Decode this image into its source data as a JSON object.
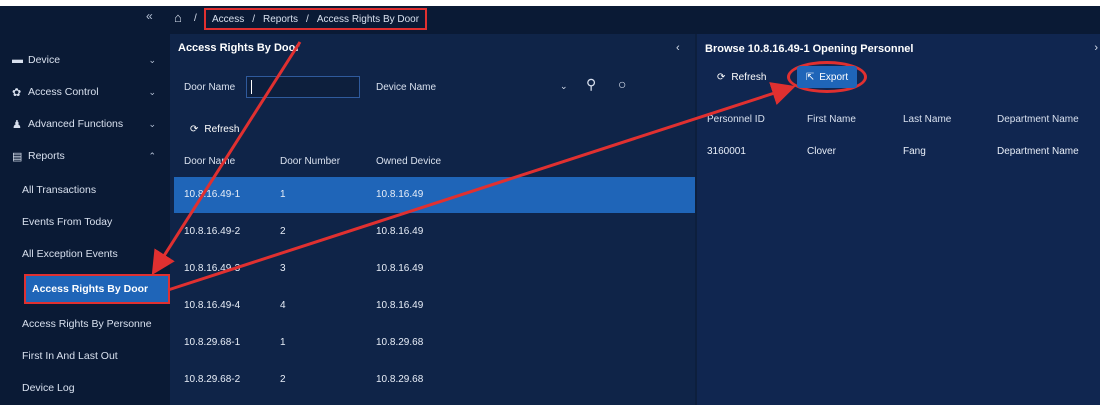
{
  "sidebar": {
    "collapse_icon": "double-chevron-left-icon",
    "items": [
      {
        "label": "Device",
        "icon": "device-icon"
      },
      {
        "label": "Access Control",
        "icon": "gear-icon"
      },
      {
        "label": "Advanced Functions",
        "icon": "person-icon"
      },
      {
        "label": "Reports",
        "icon": "report-icon"
      }
    ],
    "sub_items": [
      "All Transactions",
      "Events From Today",
      "All Exception Events",
      "Access Rights By Door",
      "Access Rights By Personne",
      "First In And Last Out",
      "Device Log"
    ]
  },
  "breadcrumb": {
    "home_icon": "home-icon",
    "items": [
      "Access",
      "Reports",
      "Access Rights By Door"
    ]
  },
  "main": {
    "title": "Access Rights By Door",
    "door_name_label": "Door Name",
    "door_name_value": "",
    "device_name_label": "Device Name",
    "refresh_label": "Refresh",
    "columns": [
      "Door Name",
      "Door Number",
      "Owned Device"
    ],
    "rows": [
      {
        "door": "10.8.16.49-1",
        "number": "1",
        "device": "10.8.16.49"
      },
      {
        "door": "10.8.16.49-2",
        "number": "2",
        "device": "10.8.16.49"
      },
      {
        "door": "10.8.16.49-3",
        "number": "3",
        "device": "10.8.16.49"
      },
      {
        "door": "10.8.16.49-4",
        "number": "4",
        "device": "10.8.16.49"
      },
      {
        "door": "10.8.29.68-1",
        "number": "1",
        "device": "10.8.29.68"
      },
      {
        "door": "10.8.29.68-2",
        "number": "2",
        "device": "10.8.29.68"
      }
    ]
  },
  "right_panel": {
    "title": "Browse 10.8.16.49-1 Opening Personnel",
    "refresh_label": "Refresh",
    "export_label": "Export",
    "columns": [
      "Personnel ID",
      "First Name",
      "Last Name",
      "Department Name"
    ],
    "rows": [
      {
        "id": "3160001",
        "first": "Clover",
        "last": "Fang",
        "dept": "Department Name"
      }
    ]
  },
  "colors": {
    "background": "#0d1f3d",
    "accent": "#1f65b8",
    "highlight": "#e03030"
  }
}
